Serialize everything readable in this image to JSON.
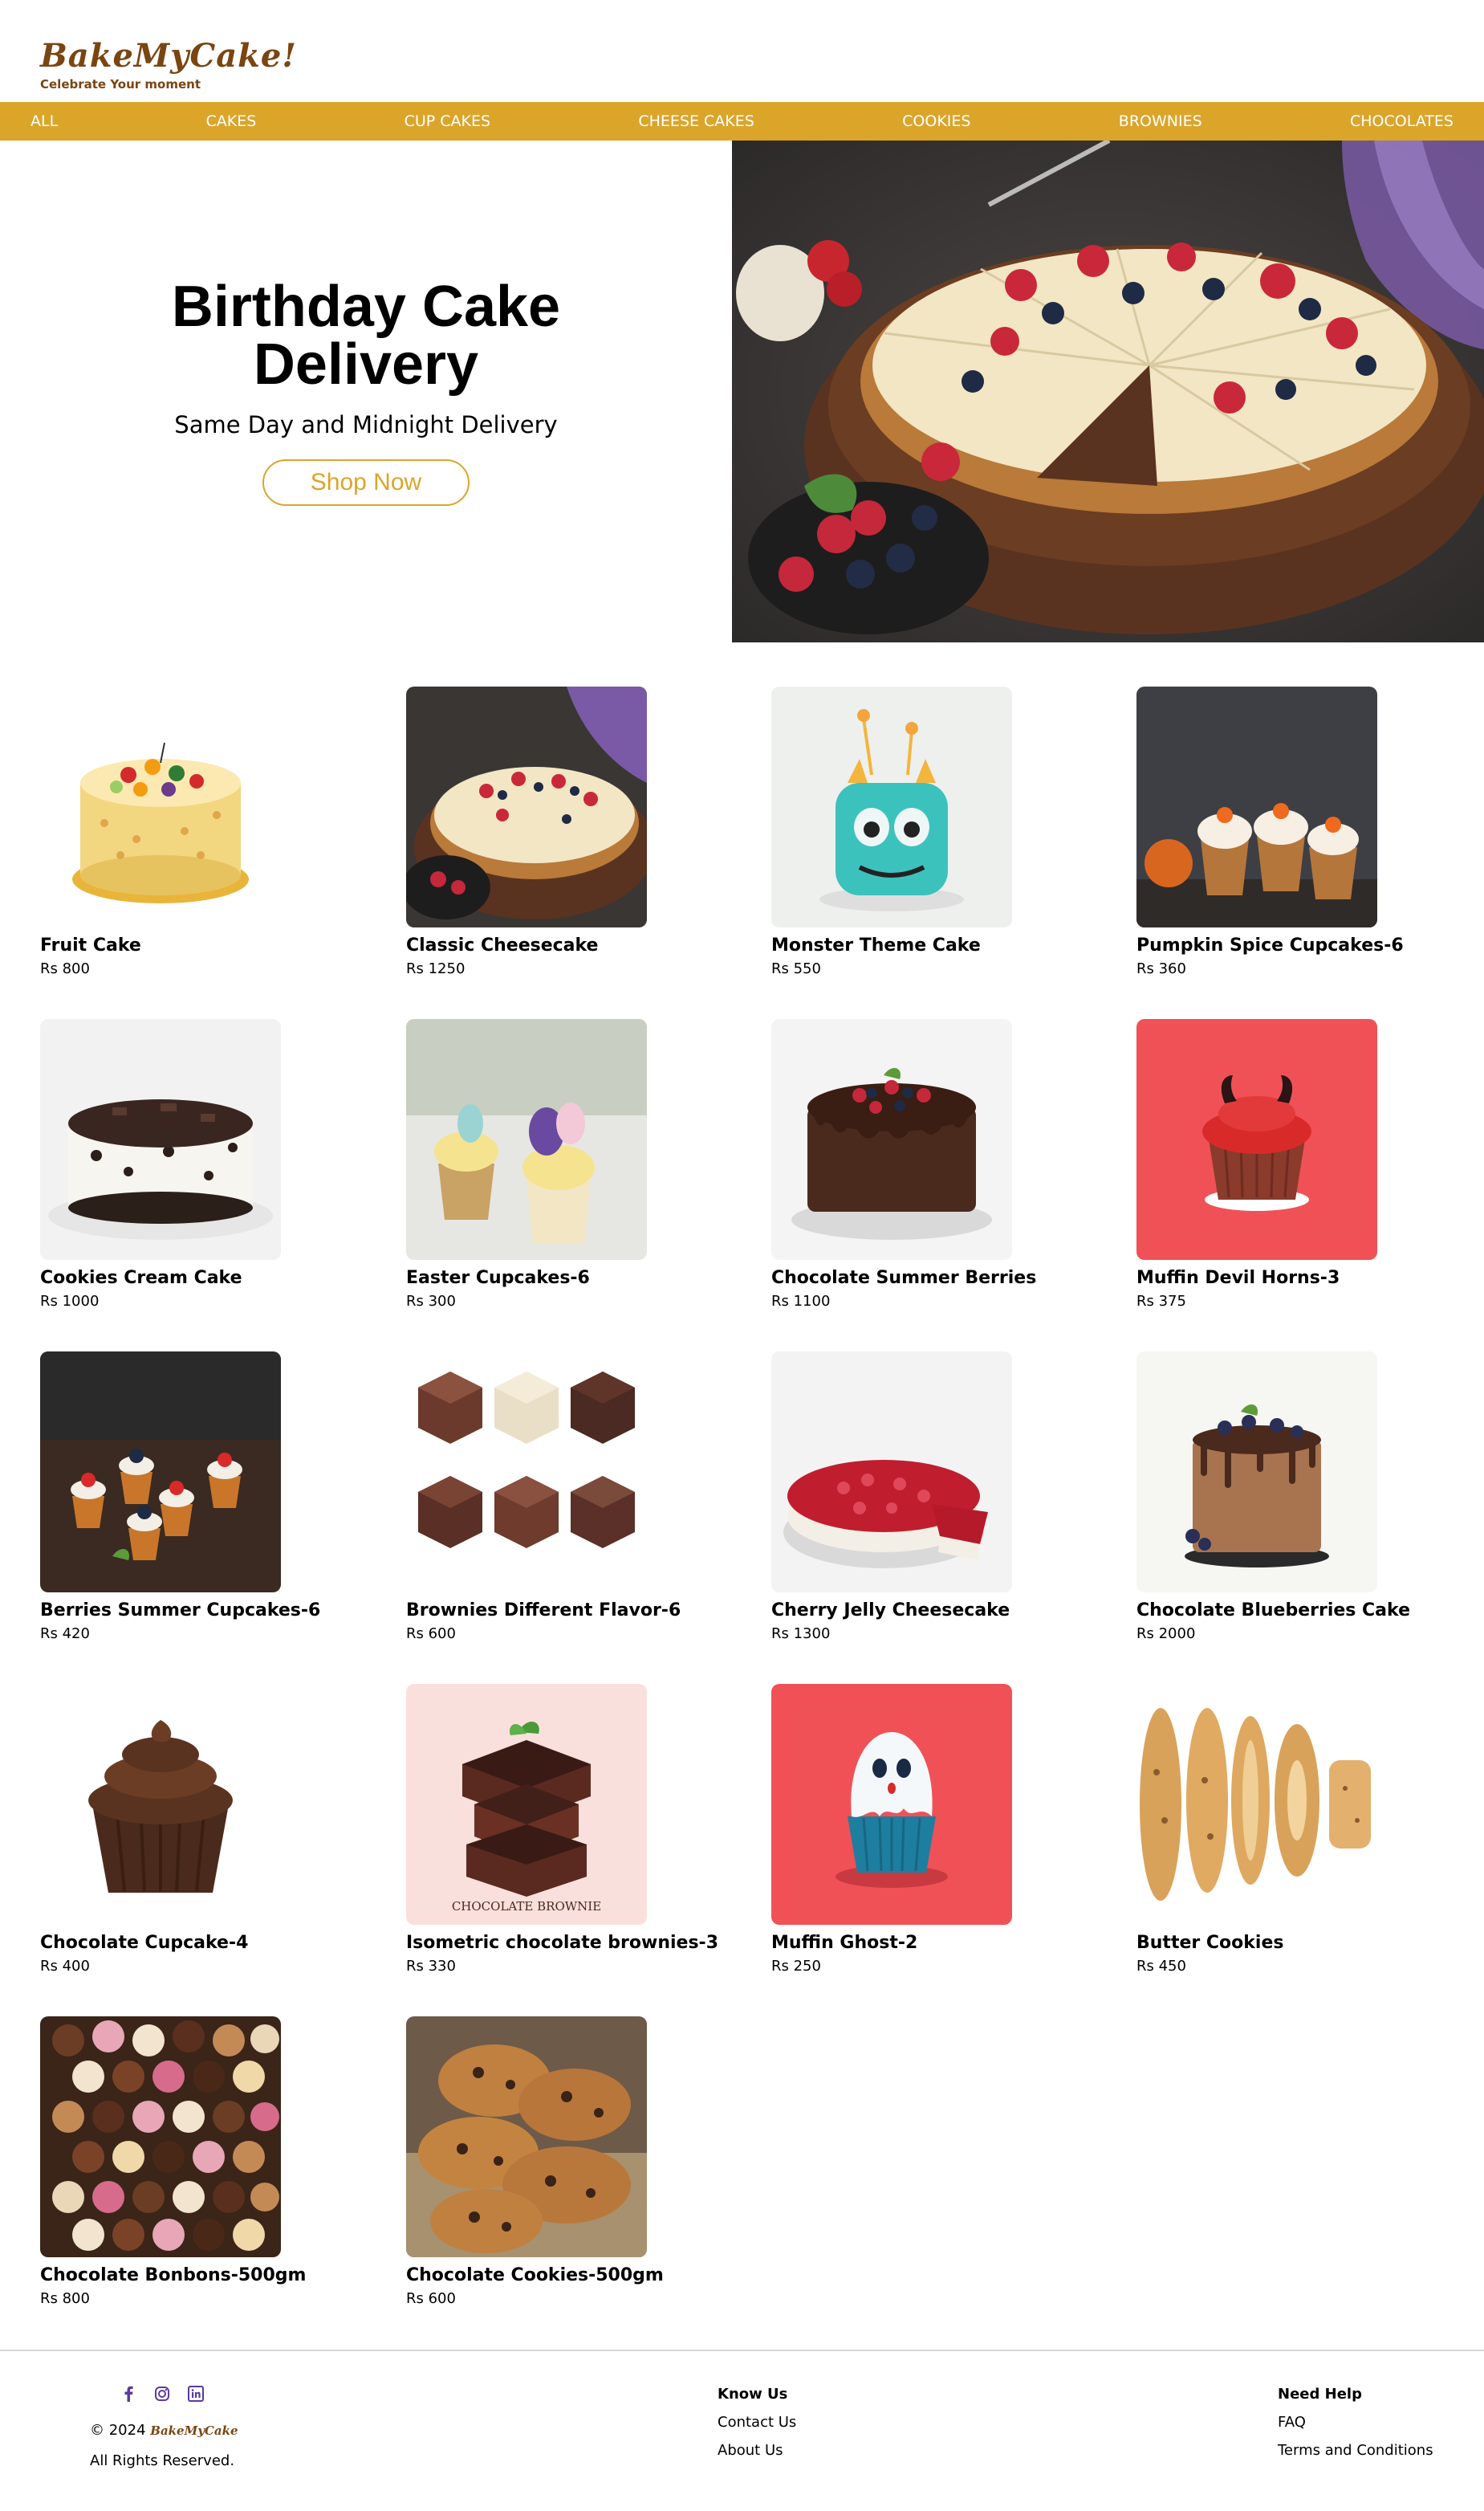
{
  "brand": {
    "name": "BakeMyCake!",
    "tagline": "Celebrate Your moment"
  },
  "nav": [
    "ALL",
    "CAKES",
    "CUP CAKES",
    "CHEESE CAKES",
    "COOKIES",
    "BROWNIES",
    "CHOCOLATES"
  ],
  "hero": {
    "title": "Birthday Cake Delivery",
    "subtitle": "Same Day and Midnight Delivery",
    "button": "Shop Now"
  },
  "products": [
    {
      "name": "Fruit Cake",
      "price": "Rs 800"
    },
    {
      "name": "Classic Cheesecake",
      "price": "Rs 1250"
    },
    {
      "name": "Monster Theme Cake",
      "price": "Rs 550"
    },
    {
      "name": "Pumpkin Spice Cupcakes-6",
      "price": "Rs 360"
    },
    {
      "name": "Cookies Cream Cake",
      "price": "Rs 1000"
    },
    {
      "name": "Easter Cupcakes-6",
      "price": "Rs 300"
    },
    {
      "name": "Chocolate Summer Berries",
      "price": "Rs 1100"
    },
    {
      "name": "Muffin Devil Horns-3",
      "price": "Rs 375"
    },
    {
      "name": "Berries Summer Cupcakes-6",
      "price": "Rs 420"
    },
    {
      "name": "Brownies Different Flavor-6",
      "price": "Rs 600"
    },
    {
      "name": "Cherry Jelly Cheesecake",
      "price": "Rs 1300"
    },
    {
      "name": "Chocolate Blueberries Cake",
      "price": "Rs 2000"
    },
    {
      "name": "Chocolate Cupcake-4",
      "price": "Rs 400"
    },
    {
      "name": "Isometric chocolate brownies-3",
      "price": "Rs 330"
    },
    {
      "name": "Muffin Ghost-2",
      "price": "Rs 250"
    },
    {
      "name": "Butter Cookies",
      "price": "Rs 450"
    },
    {
      "name": "Chocolate Bonbons-500gm",
      "price": "Rs 800"
    },
    {
      "name": "Chocolate Cookies-500gm",
      "price": "Rs 600"
    }
  ],
  "image_labels": {
    "brownie_poster": "CHOCOLATE BROWNIE"
  },
  "footer": {
    "social_icons": [
      "facebook-icon",
      "instagram-icon",
      "linkedin-icon"
    ],
    "copyright": "© 2024",
    "copyright_brand": "BakeMyCake",
    "rights": "All Rights Reserved.",
    "know_us": {
      "heading": "Know Us",
      "links": [
        "Contact Us",
        "About Us"
      ]
    },
    "need_help": {
      "heading": "Need Help",
      "links": [
        "FAQ",
        "Terms and Conditions"
      ]
    }
  },
  "colors": {
    "accent": "#dba52a",
    "brand": "#7a4512",
    "social": "#5a3aa0"
  }
}
